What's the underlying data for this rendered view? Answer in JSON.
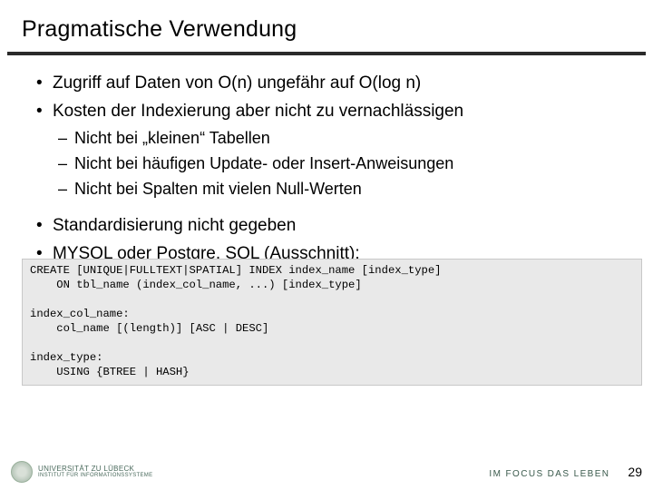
{
  "title": "Pragmatische Verwendung",
  "bullets": {
    "b1": "Zugriff auf Daten von O(n) ungefähr auf O(log n)",
    "b2": "Kosten der Indexierung aber nicht zu vernachlässigen",
    "s1": "Nicht bei „kleinen“ Tabellen",
    "s2": "Nicht bei häufigen Update- oder Insert-Anweisungen",
    "s3": "Nicht bei Spalten mit vielen Null-Werten",
    "b3": "Standardisierung nicht gegeben",
    "b4": "MYSQL oder Postgre. SQL (Ausschnitt):"
  },
  "code": "CREATE [UNIQUE|FULLTEXT|SPATIAL] INDEX index_name [index_type]\n    ON tbl_name (index_col_name, ...) [index_type]\n\nindex_col_name:\n    col_name [(length)] [ASC | DESC]\n\nindex_type:\n    USING {BTREE | HASH}",
  "footer": {
    "uni_line1": "UNIVERSITÄT ZU LÜBECK",
    "uni_line2": "INSTITUT FÜR INFORMATIONSSYSTEME",
    "tagline": "IM FOCUS DAS LEBEN",
    "page": "29"
  }
}
